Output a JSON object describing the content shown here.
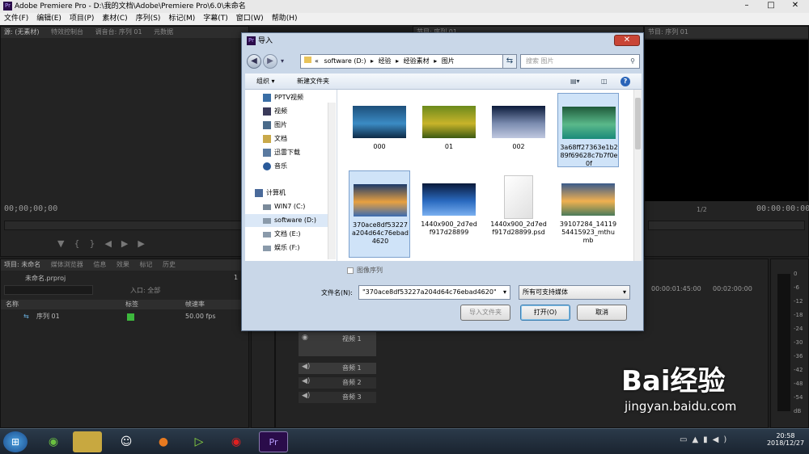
{
  "window": {
    "title": "Adobe Premiere Pro - D:\\我的文档\\Adobe\\Premiere Pro\\6.0\\未命名",
    "app_icon": "Pr",
    "controls": [
      "–",
      "□",
      "✕"
    ]
  },
  "menubar": [
    "文件(F)",
    "编辑(E)",
    "项目(P)",
    "素材(C)",
    "序列(S)",
    "标记(M)",
    "字幕(T)",
    "窗口(W)",
    "帮助(H)"
  ],
  "source_panel": {
    "tabs": [
      "源: (无素材)",
      "特效控制台",
      "调音台: 序列 01",
      "元数据"
    ],
    "timecode": "00;00;00;00"
  },
  "program_panel": {
    "tab": "节目: 序列 01",
    "timecode_left": "00;00;00;00",
    "timecode_right": "00:00:00:00",
    "zoom": "1/2"
  },
  "project_panel": {
    "tabs": [
      "项目: 未命名",
      "媒体浏览器",
      "信息",
      "效果",
      "标记",
      "历史"
    ],
    "project_file": "未命名.prproj",
    "count": "1",
    "inlabel": "入口: 全部",
    "columns": [
      "名称",
      "标签",
      "帧速率"
    ],
    "rows": [
      {
        "name": "序列 01",
        "fps": "50.00 fps",
        "label_color": "#3db83d"
      }
    ]
  },
  "timeline": {
    "ruler": [
      "00:00:01:45:00",
      "00:02:00:00"
    ],
    "tracks": [
      {
        "name": "视频 1",
        "kind": "video"
      },
      {
        "name": "音频 1",
        "kind": "audio"
      },
      {
        "name": "音频 2",
        "kind": "audio"
      },
      {
        "name": "音频 3",
        "kind": "audio"
      }
    ]
  },
  "meter_scale": [
    "0",
    "-6",
    "-12",
    "-18",
    "-24",
    "-30",
    "-36",
    "-42",
    "-48",
    "-54",
    "dB"
  ],
  "dialog": {
    "title": "导入",
    "address": [
      "«",
      "software (D:)",
      "▸",
      "经验",
      "▸",
      "经验素材",
      "▸",
      "图片"
    ],
    "search_placeholder": "搜索 图片",
    "toolbar": {
      "organize": "组织 ▾",
      "new_folder": "新建文件夹"
    },
    "nav": [
      {
        "label": "PPTV视频",
        "icon": "video-folder-icon",
        "color": "#3a6ea5"
      },
      {
        "label": "视频",
        "icon": "video-library-icon",
        "color": "#3a3a5a"
      },
      {
        "label": "图片",
        "icon": "picture-library-icon",
        "color": "#4a6a8a"
      },
      {
        "label": "文档",
        "icon": "document-library-icon",
        "color": "#c9a94a"
      },
      {
        "label": "迅雷下载",
        "icon": "download-folder-icon",
        "color": "#5a7aa0"
      },
      {
        "label": "音乐",
        "icon": "music-library-icon",
        "color": "#2a5a9a"
      },
      {
        "label": "计算机",
        "icon": "computer-icon",
        "color": "#4a6a9a"
      },
      {
        "label": "WIN7 (C:)",
        "icon": "drive-c-icon",
        "color": "#7a8a9a"
      },
      {
        "label": "software (D:)",
        "icon": "drive-d-icon",
        "color": "#8a9aaa"
      },
      {
        "label": "文档 (E:)",
        "icon": "drive-e-icon",
        "color": "#8a9aaa"
      },
      {
        "label": "娱乐 (F:)",
        "icon": "drive-f-icon",
        "color": "#8a9aaa"
      }
    ],
    "files": [
      {
        "name": "000",
        "thumb": [
          "#1d4f7a",
          "#3b8bc4",
          "#0e2a45"
        ],
        "selected": false
      },
      {
        "name": "01",
        "thumb": [
          "#6b8a1c",
          "#c8b42a",
          "#3b5a12"
        ],
        "selected": false
      },
      {
        "name": "002",
        "thumb": [
          "#0b1a3a",
          "#7b8cb0",
          "#c0c8e0"
        ],
        "selected": false
      },
      {
        "name": "3a68ff27363e1b289f69628c7b7f0e0f",
        "thumb": [
          "#1f5a3a",
          "#5ab88a",
          "#1a8a7a"
        ],
        "selected": true
      },
      {
        "name": "370ace8df53227a204d64c76ebad4620",
        "thumb": [
          "#1c3a6a",
          "#e8a040",
          "#3a6ab0"
        ],
        "selected": true
      },
      {
        "name": "1440x900_2d7edf917d28899",
        "thumb": [
          "#0a1a3a",
          "#2a6ac0",
          "#7ab0f0"
        ],
        "selected": false
      },
      {
        "name": "1440x900_2d7edf917d28899.psd",
        "thumb": [
          "#ffffff",
          "#f4f4f4",
          "#e0e0e0"
        ],
        "selected": false
      },
      {
        "name": "39107284_1411954415923_mthumb",
        "thumb": [
          "#3a5a8a",
          "#f0b050",
          "#4a7a5a"
        ],
        "selected": false
      }
    ],
    "image_sequence": "图像序列",
    "filename_label": "文件名(N):",
    "filename_value": "\"370ace8df53227a204d64c76ebad4620\"",
    "filetype": "所有可支持媒体",
    "buttons": {
      "import_folder": "导入文件夹",
      "open": "打开(O)",
      "cancel": "取消"
    }
  },
  "taskbar": {
    "time": "20:58",
    "date": "2018/12/27",
    "apps": [
      "windows-start-icon",
      "browser-360-icon",
      "explorer-icon",
      "qq-icon",
      "firefox-icon",
      "media-player-icon",
      "recorder-icon",
      "premiere-icon"
    ]
  },
  "watermark": {
    "brand": "Bai经验",
    "url": "jingyan.baidu.com"
  }
}
